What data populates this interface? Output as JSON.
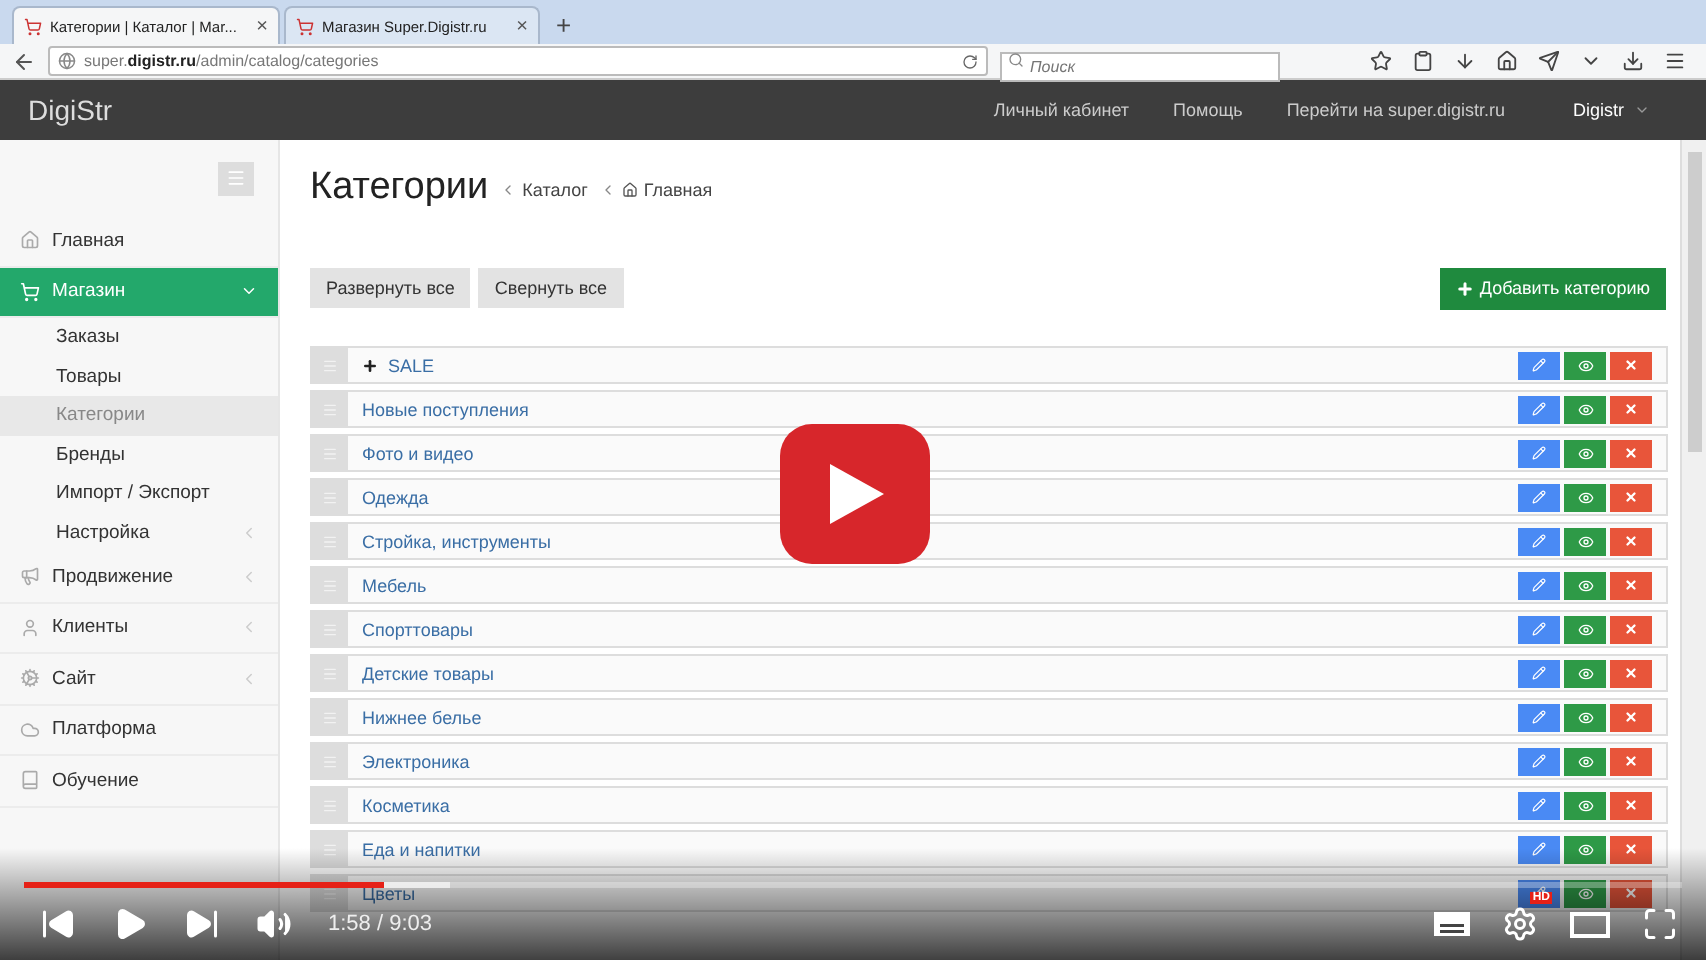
{
  "browser": {
    "tabs": [
      {
        "title": "Категории | Каталог | Mar...",
        "selected": true,
        "close": "×"
      },
      {
        "title": "Магазин Super.Digistr.ru",
        "selected": false,
        "close": "×"
      }
    ],
    "new_tab": "+",
    "address": {
      "value": "super.**digistr.ru**/admin/catalog/categories"
    },
    "search": {
      "placeholder": "Поиск"
    }
  },
  "app": {
    "brand": "DigiStr",
    "nav_links": [
      "Личный кабинет",
      "Помощь",
      "Перейти на super.digistr.ru"
    ],
    "user_menu": "Digistr"
  },
  "sidebar": {
    "items": [
      {
        "label": "Главная",
        "selected": false,
        "expandable": false
      },
      {
        "label": "Магазин",
        "selected": true,
        "expandable": true,
        "expanded": true,
        "children": [
          {
            "label": "Заказы",
            "selected": false,
            "expandable": false
          },
          {
            "label": "Товары",
            "selected": false,
            "expandable": false
          },
          {
            "label": "Категории",
            "selected": true,
            "expandable": false
          },
          {
            "label": "Бренды",
            "selected": false,
            "expandable": false
          },
          {
            "label": "Импорт / Экспорт",
            "selected": false,
            "expandable": false
          },
          {
            "label": "Настройка",
            "selected": false,
            "expandable": true
          }
        ]
      },
      {
        "label": "Продвижение",
        "selected": false,
        "expandable": true,
        "expanded": false
      },
      {
        "label": "Клиенты",
        "selected": false,
        "expandable": true,
        "expanded": false
      },
      {
        "label": "Сайт",
        "selected": false,
        "expandable": true,
        "expanded": false
      },
      {
        "label": "Платформа",
        "selected": false,
        "expandable": false
      },
      {
        "label": "Обучение",
        "selected": false,
        "expandable": false
      }
    ]
  },
  "page": {
    "title": "Категории",
    "breadcrumbs": [
      "Каталог",
      "Главная"
    ],
    "buttons": [
      "Развернуть все",
      "Свернуть все"
    ],
    "add_button": "Добавить категорию",
    "categories": [
      {
        "name": "SALE",
        "has_children": true
      },
      {
        "name": "Новые поступления",
        "has_children": false
      },
      {
        "name": "Фото и видео",
        "has_children": false
      },
      {
        "name": "Одежда",
        "has_children": false
      },
      {
        "name": "Стройка, инструменты",
        "has_children": false
      },
      {
        "name": "Мебель",
        "has_children": false
      },
      {
        "name": "Спорттовары",
        "has_children": false
      },
      {
        "name": "Детские товары",
        "has_children": false
      },
      {
        "name": "Нижнее белье",
        "has_children": false
      },
      {
        "name": "Электроника",
        "has_children": false
      },
      {
        "name": "Косметика",
        "has_children": false
      },
      {
        "name": "Еда и напитки",
        "has_children": false
      },
      {
        "name": "Цветы",
        "has_children": false
      }
    ]
  },
  "player": {
    "progress": {
      "level": 0.217
    },
    "buffer": {
      "level": 0.257
    },
    "time": "1:58 / 9:03",
    "hd_badge": "HD"
  }
}
